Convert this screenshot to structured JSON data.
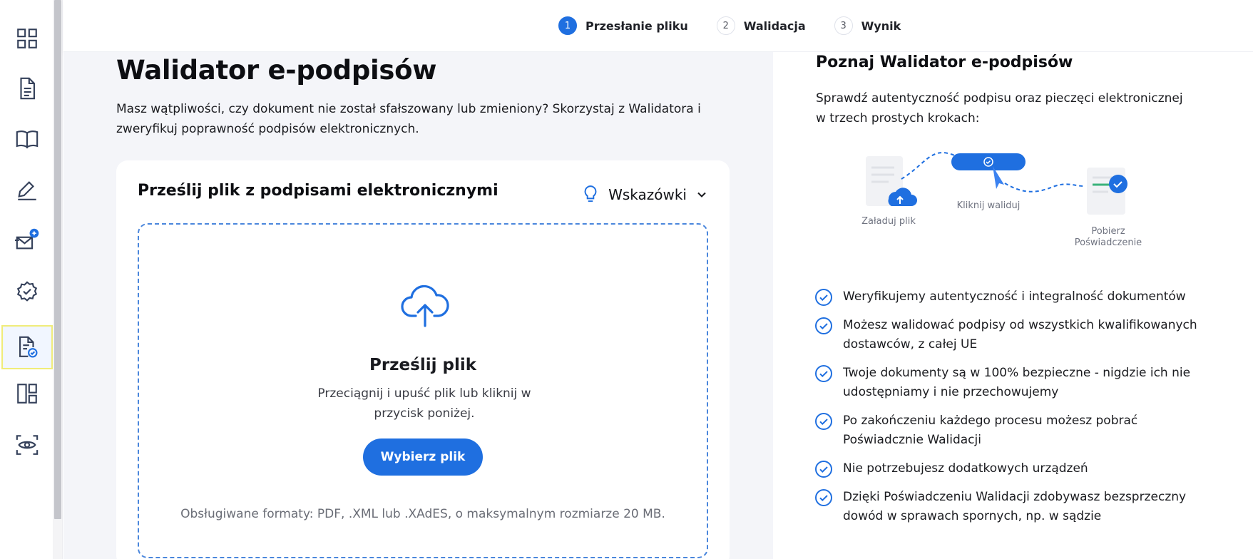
{
  "sidebar": {
    "items": [
      {
        "icon": "dashboard-grid-icon"
      },
      {
        "icon": "document-icon"
      },
      {
        "icon": "book-icon"
      },
      {
        "icon": "signature-pen-icon"
      },
      {
        "icon": "envelope-ai-icon"
      },
      {
        "icon": "certificate-badge-icon"
      },
      {
        "icon": "document-check-icon",
        "active": true
      },
      {
        "icon": "layout-panels-icon"
      },
      {
        "icon": "eye-scan-icon"
      }
    ]
  },
  "stepper": {
    "steps": [
      {
        "num": "1",
        "label": "Przesłanie pliku",
        "active": true
      },
      {
        "num": "2",
        "label": "Walidacja"
      },
      {
        "num": "3",
        "label": "Wynik"
      }
    ]
  },
  "main": {
    "title": "Walidator e-podpisów",
    "intro": "Masz wątpliwości, czy dokument nie został sfałszowany lub zmieniony? Skorzystaj z Walidatora i zweryfikuj poprawność podpisów elektronicznych.",
    "card": {
      "title": "Prześlij plik z podpisami elektronicznymi",
      "hints_label": "Wskazówki",
      "dropzone": {
        "title": "Prześlij plik",
        "text": "Przeciągnij i upuść plik lub kliknij w przycisk poniżej.",
        "button": "Wybierz plik",
        "formats": "Obsługiwane formaty: PDF, .XML lub .XAdES, o maksymalnym rozmiarze 20 MB."
      }
    }
  },
  "right": {
    "title": "Poznaj Walidator e-podpisów",
    "subtitle": "Sprawdź autentyczność podpisu oraz pieczęci elektronicznej w trzech prostych krokach:",
    "illustration": {
      "step1": "Załaduj plik",
      "step2": "Kliknij waliduj",
      "step3_line1": "Pobierz",
      "step3_line2": "Poświadczenie"
    },
    "features": [
      "Weryfikujemy autentyczność i integralność dokumentów",
      "Możesz walidować podpisy od wszystkich kwalifikowanych dostawców, z całej UE",
      "Twoje dokumenty są w 100% bezpieczne - nigdzie ich nie udostępniamy i nie przechowujemy",
      "Po zakończeniu każdego procesu możesz pobrać Poświadcznie Walidacji",
      "Nie potrzebujesz dodatkowych urządzeń",
      "Dzięki Poświadczeniu Walidacji zdobywasz bezsprzeczny dowód w sprawach spornych, np. w sądzie"
    ]
  },
  "colors": {
    "accent": "#1f6fe0",
    "icon": "#34405a",
    "main_bg": "#f4f5f9"
  }
}
